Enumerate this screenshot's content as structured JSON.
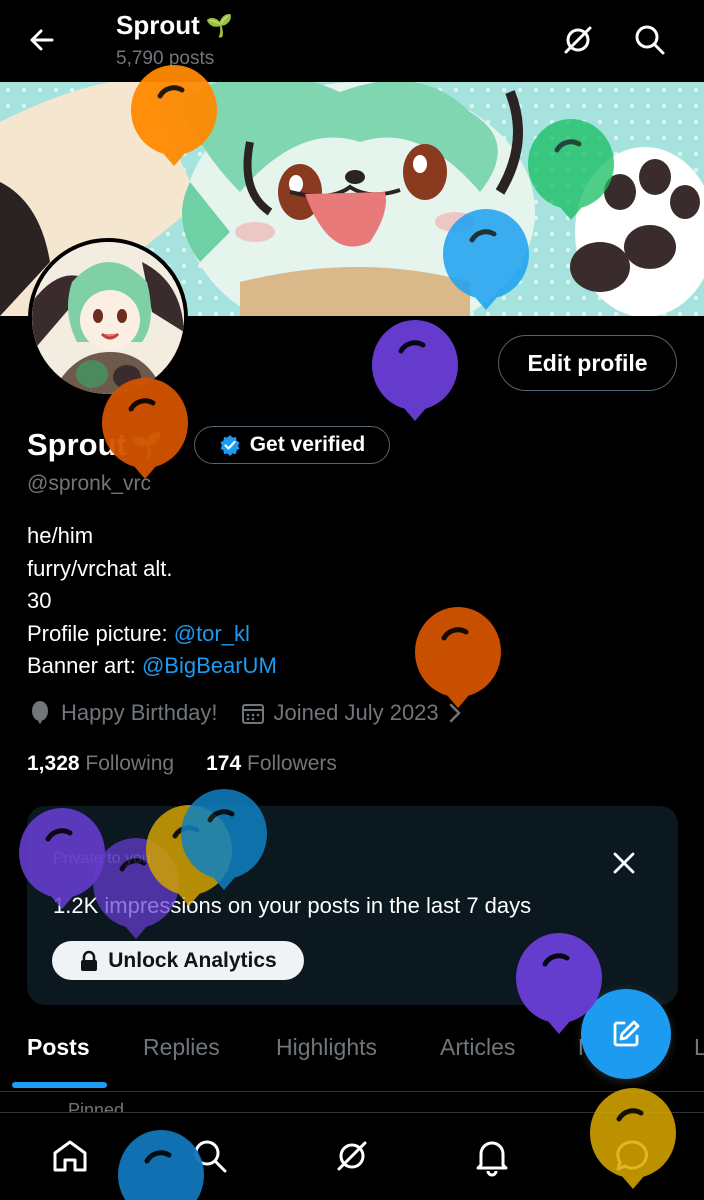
{
  "header": {
    "title": "Sprout",
    "title_emoji": "🌱",
    "post_count": "5,790 posts"
  },
  "profile": {
    "display_name": "Sprout",
    "name_emoji": "🌱",
    "get_verified_label": "Get verified",
    "edit_profile_label": "Edit profile",
    "handle": "@spronk_vrc",
    "bio_lines": [
      "he/him",
      "furry/vrchat alt.",
      "30"
    ],
    "profile_picture_label": "Profile picture: ",
    "profile_picture_credit": "@tor_kl",
    "banner_art_label": "Banner art: ",
    "banner_art_credit": "@BigBearUM",
    "birthday_text": "Happy Birthday!",
    "joined_text": "Joined July 2023",
    "following_count": "1,328",
    "following_label": "Following",
    "followers_count": "174",
    "followers_label": "Followers"
  },
  "analytics_card": {
    "private_label": "Private to you",
    "impressions_text": "1.2K impressions on your posts in the last 7 days",
    "unlock_label": "Unlock Analytics"
  },
  "tabs": [
    "Posts",
    "Replies",
    "Highlights",
    "Articles",
    "M",
    "L"
  ],
  "active_tab": "Posts",
  "pinned_label": "Pinned",
  "colors": {
    "accent": "#1d9bf0",
    "background": "#000000",
    "muted_text": "#71767b",
    "card_bg": "#0b1820",
    "banner_bg": "#a6e3de",
    "balloon_orange": "#ff8a00",
    "balloon_dark_orange": "#d35400",
    "balloon_purple": "#6a3fd8",
    "balloon_blue": "#1da1f2",
    "balloon_green": "#17bf63",
    "balloon_gold": "#ddaa00"
  },
  "icons": {
    "back": "arrow-left-icon",
    "grok": "grok-icon",
    "search": "search-icon",
    "balloon": "balloon-icon",
    "calendar": "calendar-icon",
    "verified": "verified-badge-icon",
    "lock": "lock-icon",
    "close": "close-icon",
    "compose": "compose-icon",
    "home": "home-icon",
    "notifications": "bell-icon",
    "messages": "chat-icon"
  }
}
